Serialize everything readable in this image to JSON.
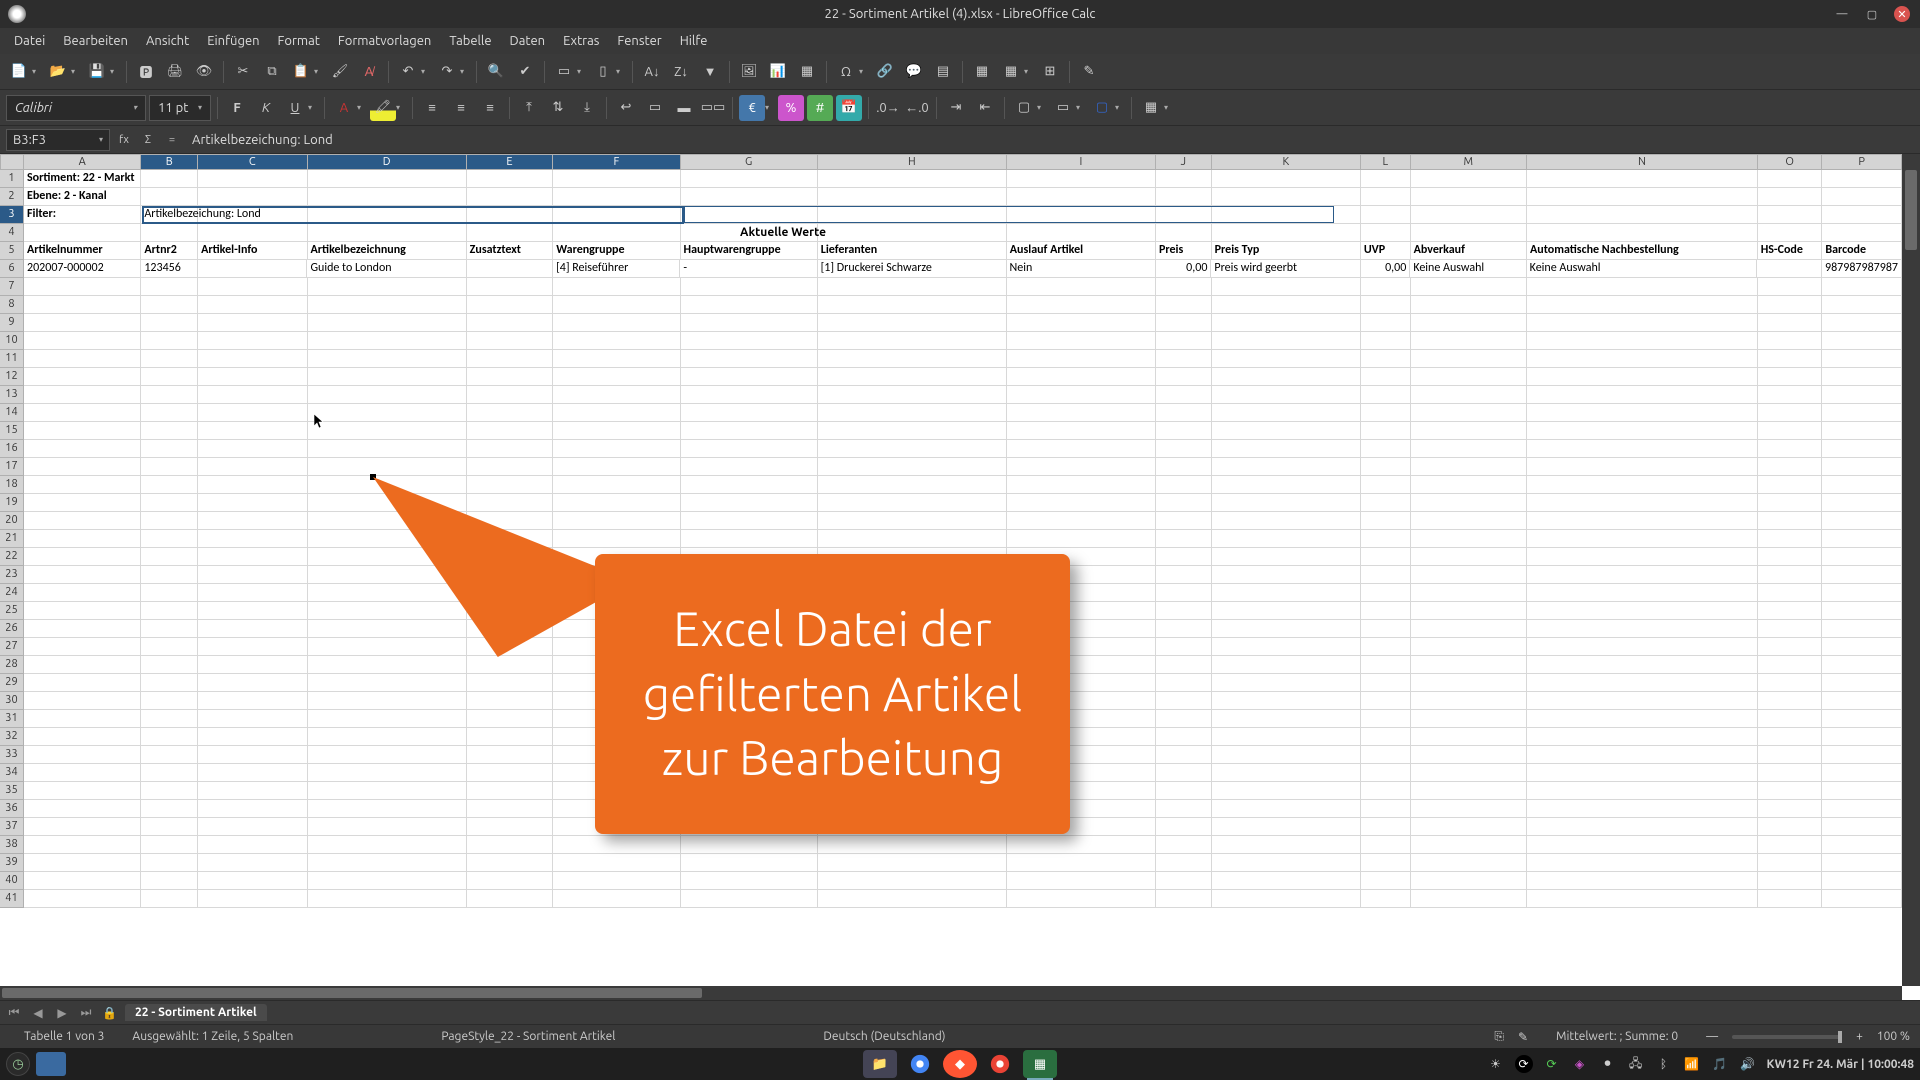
{
  "window": {
    "title": "22 - Sortiment Artikel (4).xlsx - LibreOffice Calc"
  },
  "menu": [
    "Datei",
    "Bearbeiten",
    "Ansicht",
    "Einfügen",
    "Format",
    "Formatvorlagen",
    "Tabelle",
    "Daten",
    "Extras",
    "Fenster",
    "Hilfe"
  ],
  "format": {
    "font_name": "Calibri",
    "font_size": "11 pt"
  },
  "cellref": {
    "ref": "B3:F3",
    "formula": "Artikelbezeichung: Lond"
  },
  "columns": [
    "A",
    "B",
    "C",
    "D",
    "E",
    "F",
    "G",
    "H",
    "I",
    "J",
    "K",
    "L",
    "M",
    "N",
    "O",
    "P"
  ],
  "selected_columns": [
    "B",
    "C",
    "D",
    "E",
    "F"
  ],
  "selected_row": 3,
  "sheet": {
    "row1": {
      "A": "Sortiment: 22 - Markt"
    },
    "row2": {
      "A": "Ebene: 2 - Kanal"
    },
    "row3": {
      "A": "Filter:",
      "B": "Artikelbezeichung: Lond"
    },
    "row4_center": "Aktuelle Werte",
    "headers": {
      "A": "Artikelnummer",
      "B": "Artnr2",
      "C": "Artikel-Info",
      "D": "Artikelbezeichnung",
      "E": "Zusatztext",
      "F": "Warengruppe",
      "G": "Hauptwarengruppe",
      "H": "Lieferanten",
      "I": "Auslauf Artikel",
      "J": "Preis",
      "K": "Preis Typ",
      "L": "UVP",
      "M": "Abverkauf",
      "N": "Automatische Nachbestellung",
      "O": "HS-Code",
      "P": "Barcode"
    },
    "data": [
      {
        "A": "202007-000002",
        "B": "123456",
        "C": "",
        "D": "Guide to London",
        "E": "",
        "F": "[4] Reiseführer",
        "G": "-",
        "H": "[1] Druckerei Schwarze",
        "I": "Nein",
        "J": "0,00",
        "K": "Preis wird geerbt",
        "L": "0,00",
        "M": "Keine Auswahl",
        "N": "Keine Auswahl",
        "O": "",
        "P": "987987987987"
      }
    ]
  },
  "callout": {
    "line1": "Excel Datei der",
    "line2": "gefilterten Artikel",
    "line3": "zur Bearbeitung"
  },
  "tabs": {
    "active": "22 - Sortiment Artikel"
  },
  "status": {
    "sheet_pos": "Tabelle 1 von 3",
    "selection": "Ausgewählt: 1 Zeile, 5 Spalten",
    "pagestyle": "PageStyle_22 - Sortiment Artikel",
    "lang": "Deutsch (Deutschland)",
    "sums": "Mittelwert: ; Summe: 0",
    "zoom": "100 %"
  },
  "taskbar": {
    "clock": "KW12 Fr 24. Mär | 10:00:48"
  }
}
